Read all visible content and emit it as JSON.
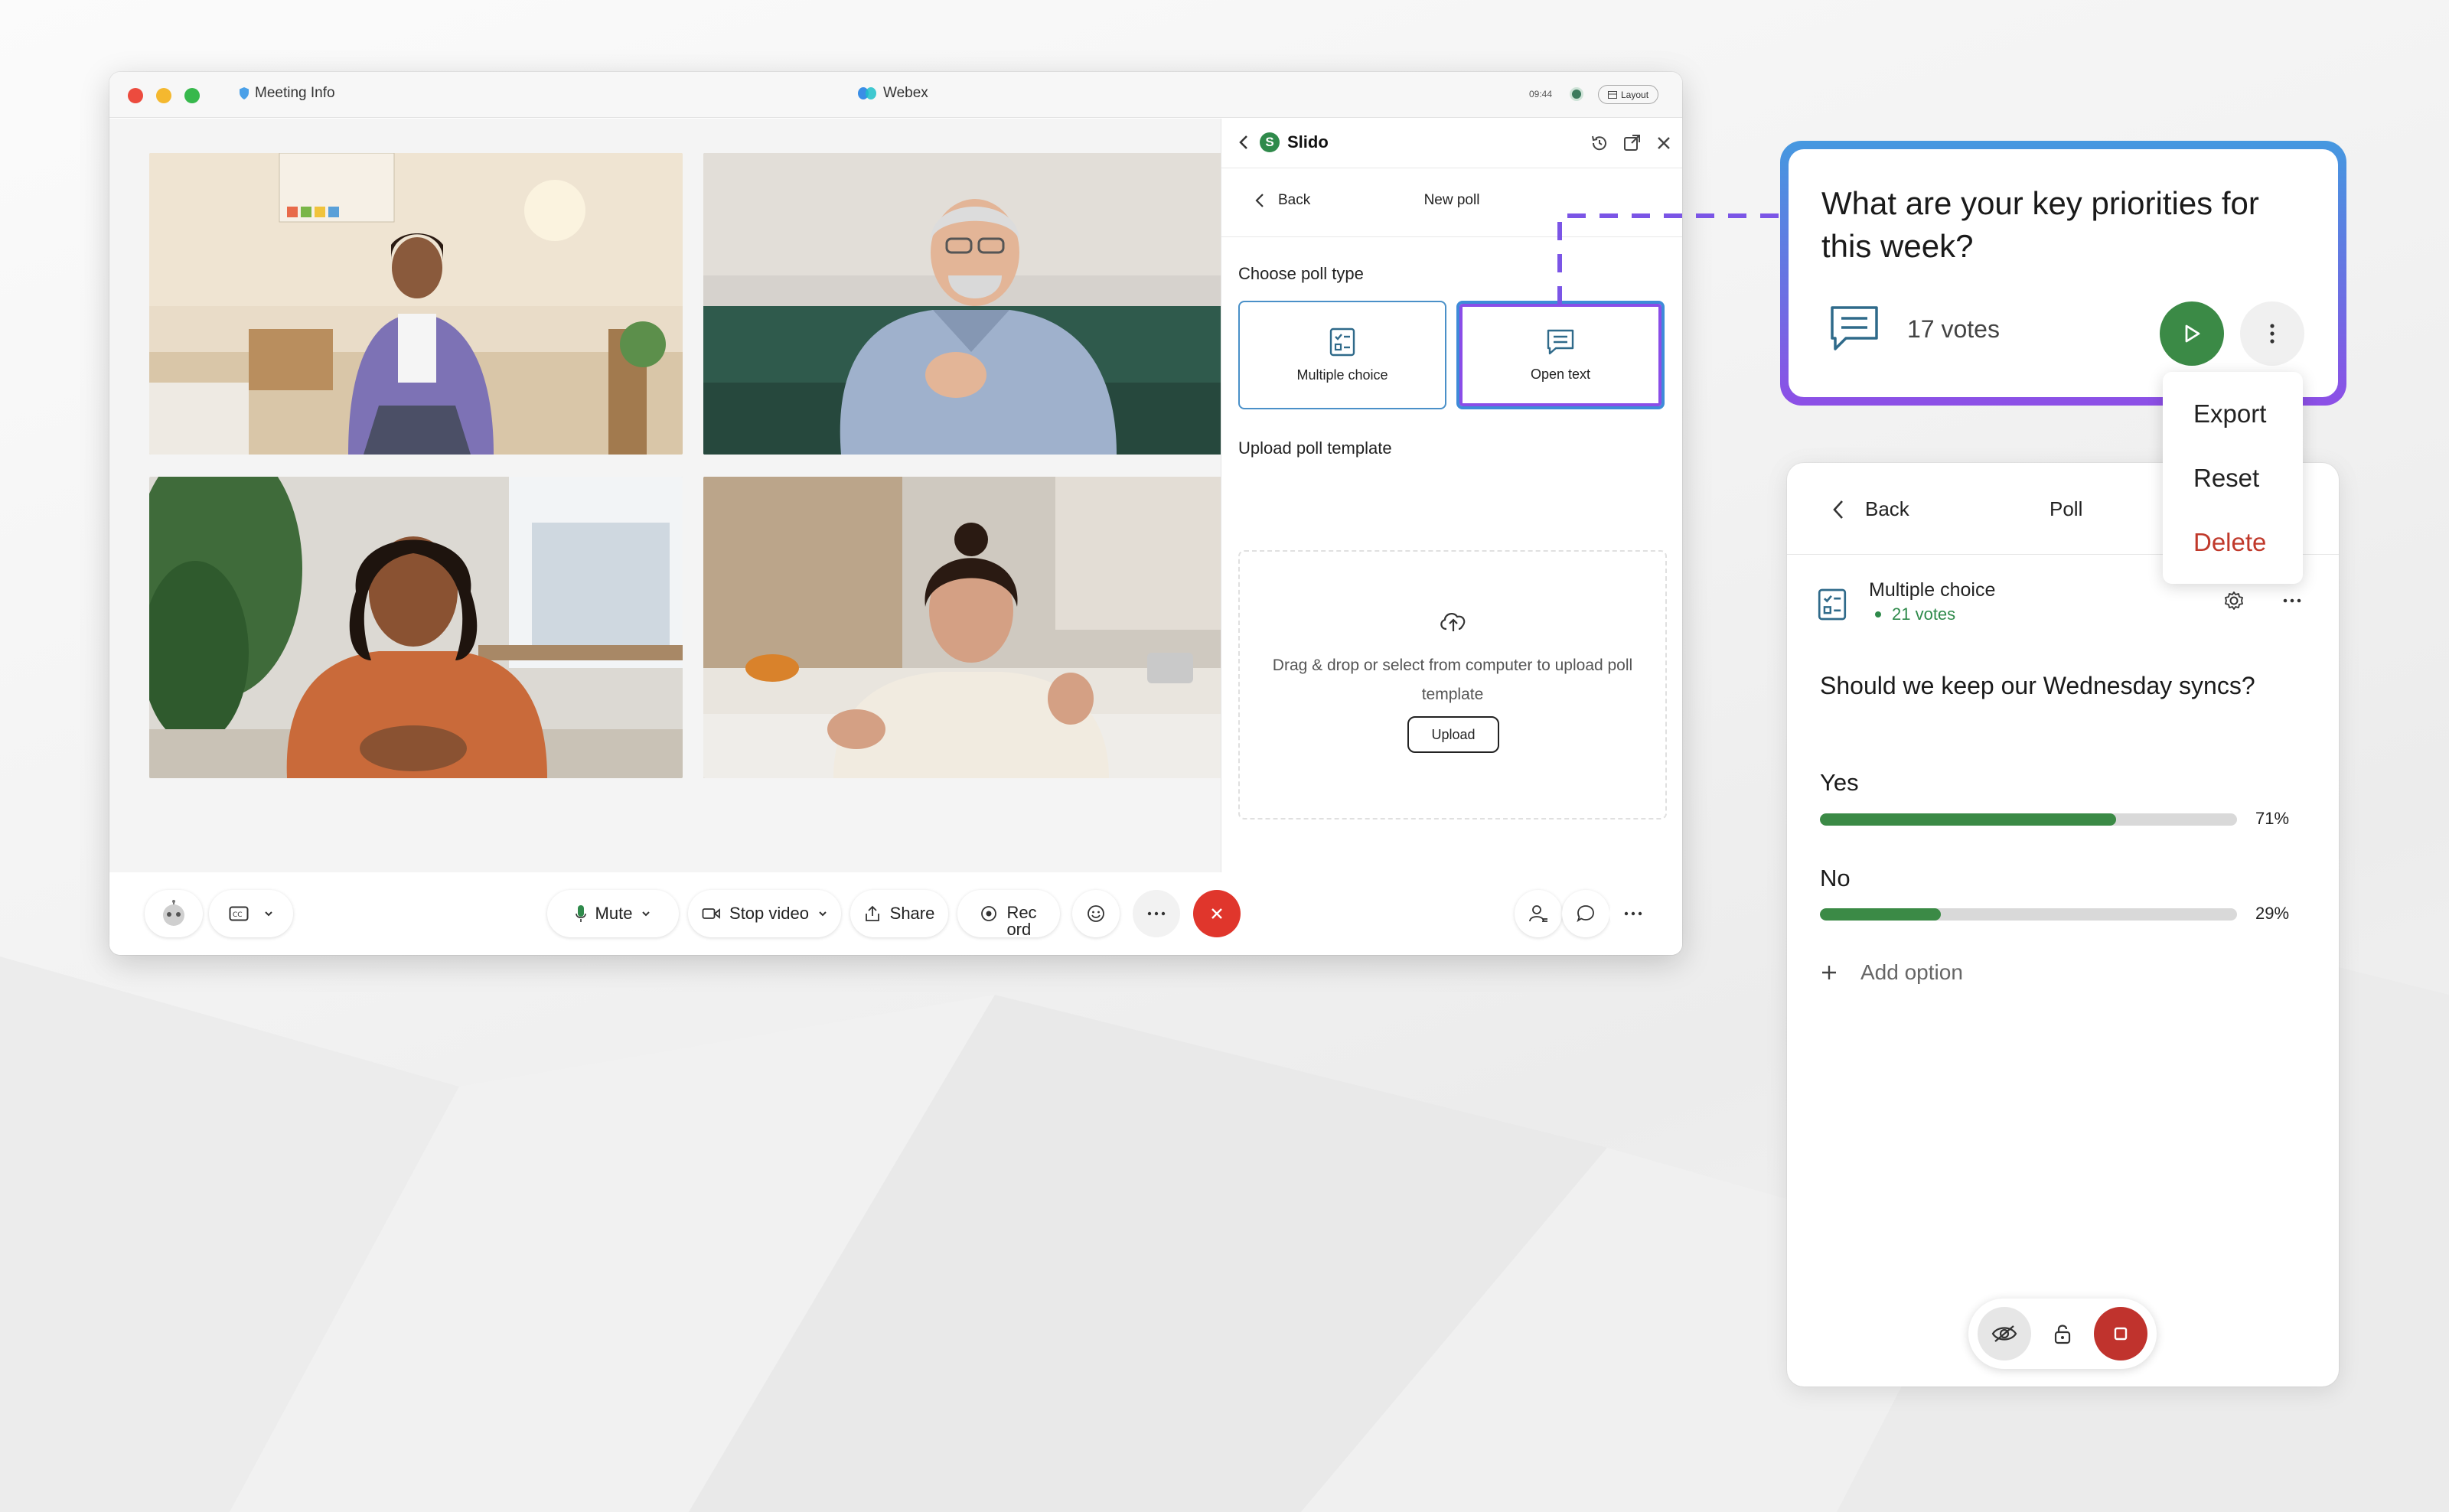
{
  "titlebar": {
    "meeting_info": "Meeting Info",
    "app_title": "Webex",
    "time": "09:44",
    "layout_label": "Layout"
  },
  "slido": {
    "title": "Slido",
    "back_label": "Back",
    "new_poll_label": "New poll",
    "choose_type_label": "Choose poll type",
    "types": [
      {
        "label": "Multiple choice",
        "icon": "checklist-icon"
      },
      {
        "label": "Open text",
        "icon": "chat-lines-icon"
      }
    ],
    "upload_section_label": "Upload poll template",
    "upload_text": "Drag & drop or select from computer to upload poll template",
    "upload_button": "Upload"
  },
  "controls": {
    "mute_label": "Mute",
    "stop_video_label": "Stop video",
    "share_label": "Share",
    "record_label": "Rec\nord"
  },
  "question_card": {
    "question": "What are your key priorities for this week?",
    "votes": "17 votes"
  },
  "context_menu": {
    "items": [
      "Export",
      "Reset",
      "Delete"
    ]
  },
  "poll": {
    "back_label": "Back",
    "title": "Poll",
    "type_label": "Multiple choice",
    "votes": "21 votes",
    "question": "Should we keep our Wednesday syncs?",
    "options": [
      {
        "label": "Yes",
        "percent": 71,
        "percent_label": "71%"
      },
      {
        "label": "No",
        "percent": 29,
        "percent_label": "29%"
      }
    ],
    "add_option_label": "Add option"
  },
  "colors": {
    "accent_green": "#3b8a46",
    "end_call_red": "#e0362c",
    "delete_red": "#c0392b",
    "selection_blue": "#4a93dc",
    "selection_purple": "#8d4fe6"
  }
}
